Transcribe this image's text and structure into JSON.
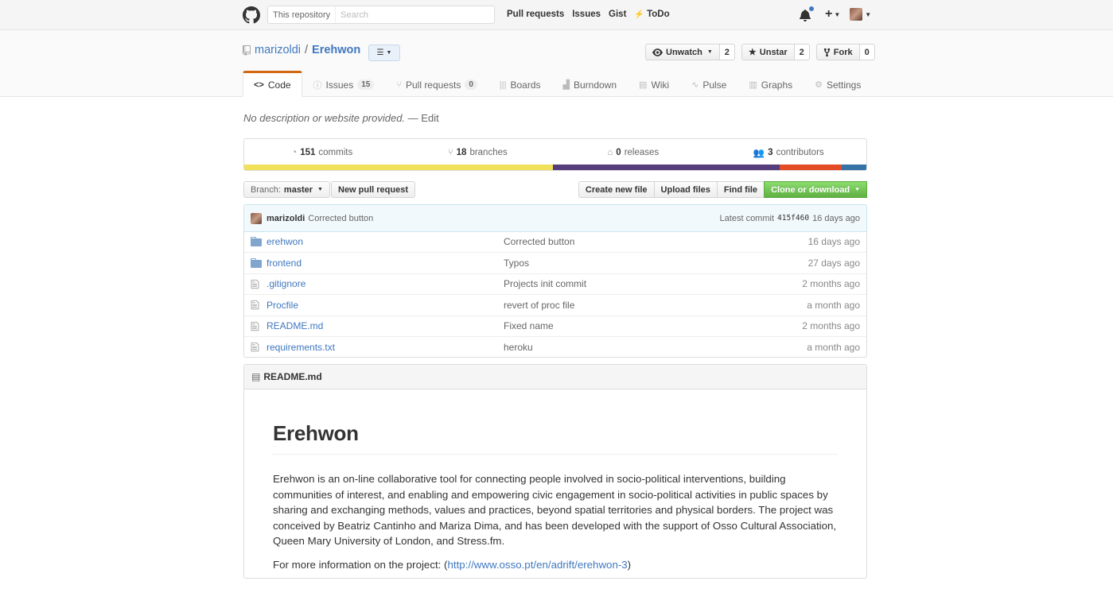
{
  "header": {
    "search_scope": "This repository",
    "search_placeholder": "Search",
    "nav": [
      "Pull requests",
      "Issues",
      "Gist",
      "ToDo"
    ],
    "todo_glyph": "⚡"
  },
  "repo": {
    "owner": "marizoldi",
    "separator": "/",
    "name": "Erehwon",
    "watch_label": "Unwatch",
    "watch_count": "2",
    "star_label": "Unstar",
    "star_count": "2",
    "fork_label": "Fork",
    "fork_count": "0"
  },
  "tabs": [
    {
      "label": "Code",
      "icon": "code-icon",
      "count": ""
    },
    {
      "label": "Issues",
      "icon": "issue-icon",
      "count": "15"
    },
    {
      "label": "Pull requests",
      "icon": "pull-request-icon",
      "count": "0"
    },
    {
      "label": "Boards",
      "icon": "boards-icon",
      "count": ""
    },
    {
      "label": "Burndown",
      "icon": "burndown-icon",
      "count": ""
    },
    {
      "label": "Wiki",
      "icon": "wiki-icon",
      "count": ""
    },
    {
      "label": "Pulse",
      "icon": "pulse-icon",
      "count": ""
    },
    {
      "label": "Graphs",
      "icon": "graph-icon",
      "count": ""
    },
    {
      "label": "Settings",
      "icon": "gear-icon",
      "count": ""
    }
  ],
  "description": {
    "text": "No description or website provided.",
    "edit_label": "— Edit"
  },
  "summary": {
    "commits_num": "151",
    "commits_label": "commits",
    "branches_num": "18",
    "branches_label": "branches",
    "releases_num": "0",
    "releases_label": "releases",
    "contributors_num": "3",
    "contributors_label": "contributors"
  },
  "language_bar": [
    {
      "fraction": 0.496,
      "color": "#f1e05a"
    },
    {
      "fraction": 0.365,
      "color": "#563d7c"
    },
    {
      "fraction": 0.099,
      "color": "#e34c26"
    },
    {
      "fraction": 0.04,
      "color": "#3572A5"
    }
  ],
  "file_nav": {
    "branch_prefix": "Branch:",
    "branch_name": "master",
    "new_pr_label": "New pull request",
    "create_file_label": "Create new file",
    "upload_label": "Upload files",
    "find_label": "Find file",
    "clone_label": "Clone or download"
  },
  "latest_commit": {
    "author": "marizoldi",
    "message": "Corrected button",
    "prefix": "Latest commit",
    "sha": "415f460",
    "age": "16 days ago"
  },
  "files": [
    {
      "name": "erehwon",
      "type": "folder",
      "message": "Corrected button",
      "age": "16 days ago"
    },
    {
      "name": "frontend",
      "type": "folder",
      "message": "Typos",
      "age": "27 days ago"
    },
    {
      "name": ".gitignore",
      "type": "file",
      "message": "Projects init commit",
      "age": "2 months ago"
    },
    {
      "name": "Procfile",
      "type": "file",
      "message": "revert of proc file",
      "age": "a month ago"
    },
    {
      "name": "README.md",
      "type": "file",
      "message": "Fixed name",
      "age": "2 months ago"
    },
    {
      "name": "requirements.txt",
      "type": "file",
      "message": "heroku",
      "age": "a month ago"
    }
  ],
  "readme": {
    "filename": "README.md",
    "title": "Erehwon",
    "paragraph": "Erehwon is an on-line collaborative tool for connecting people involved in socio-political interventions, building communities of interest, and enabling and empowering civic engagement in socio-political activities in public spaces by sharing and exchanging methods, values and practices, beyond spatial territories and physical borders. The project was conceived by Beatriz Cantinho and Mariza Dima, and has been developed with the support of Osso Cultural Association, Queen Mary University of London, and Stress.fm.",
    "more_info_prefix": "For more information on the project: (",
    "more_info_link": "http://www.osso.pt/en/adrift/erehwon-3",
    "more_info_suffix": ")"
  }
}
